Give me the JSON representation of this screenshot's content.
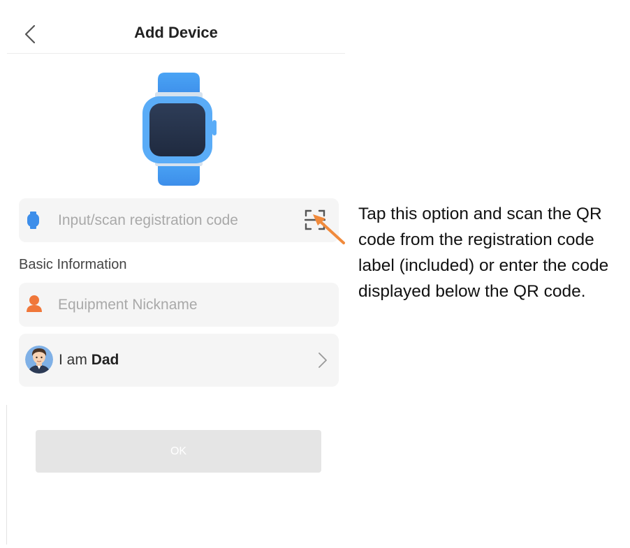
{
  "header": {
    "title": "Add Device",
    "back_icon": "chevron-left-icon"
  },
  "device_image": {
    "icon": "smartwatch-icon",
    "band_color": "#4a9df2",
    "screen_color": "#2f3f5c"
  },
  "registration_field": {
    "placeholder": "Input/scan registration code",
    "value": "",
    "icon": "watch-dot-icon",
    "scan_icon": "qr-scan-icon"
  },
  "basic_info": {
    "section_label": "Basic Information",
    "nickname_field": {
      "placeholder": "Equipment Nickname",
      "value": "",
      "icon": "person-icon"
    },
    "role": {
      "prefix": "I am",
      "value": "Dad",
      "avatar": "avatar-dad",
      "chevron_icon": "chevron-right-icon"
    }
  },
  "ok_button": {
    "label": "OK",
    "state": "disabled"
  },
  "annotation": {
    "text": "Tap this option and scan the QR code from the registration code label (included) or enter the code displayed below the QR code.",
    "arrow_color": "#f08a3c"
  },
  "colors": {
    "accent_blue": "#3d8eea",
    "accent_orange": "#f0773a",
    "field_bg": "#f5f5f5",
    "disabled_button": "#e5e5e5"
  }
}
